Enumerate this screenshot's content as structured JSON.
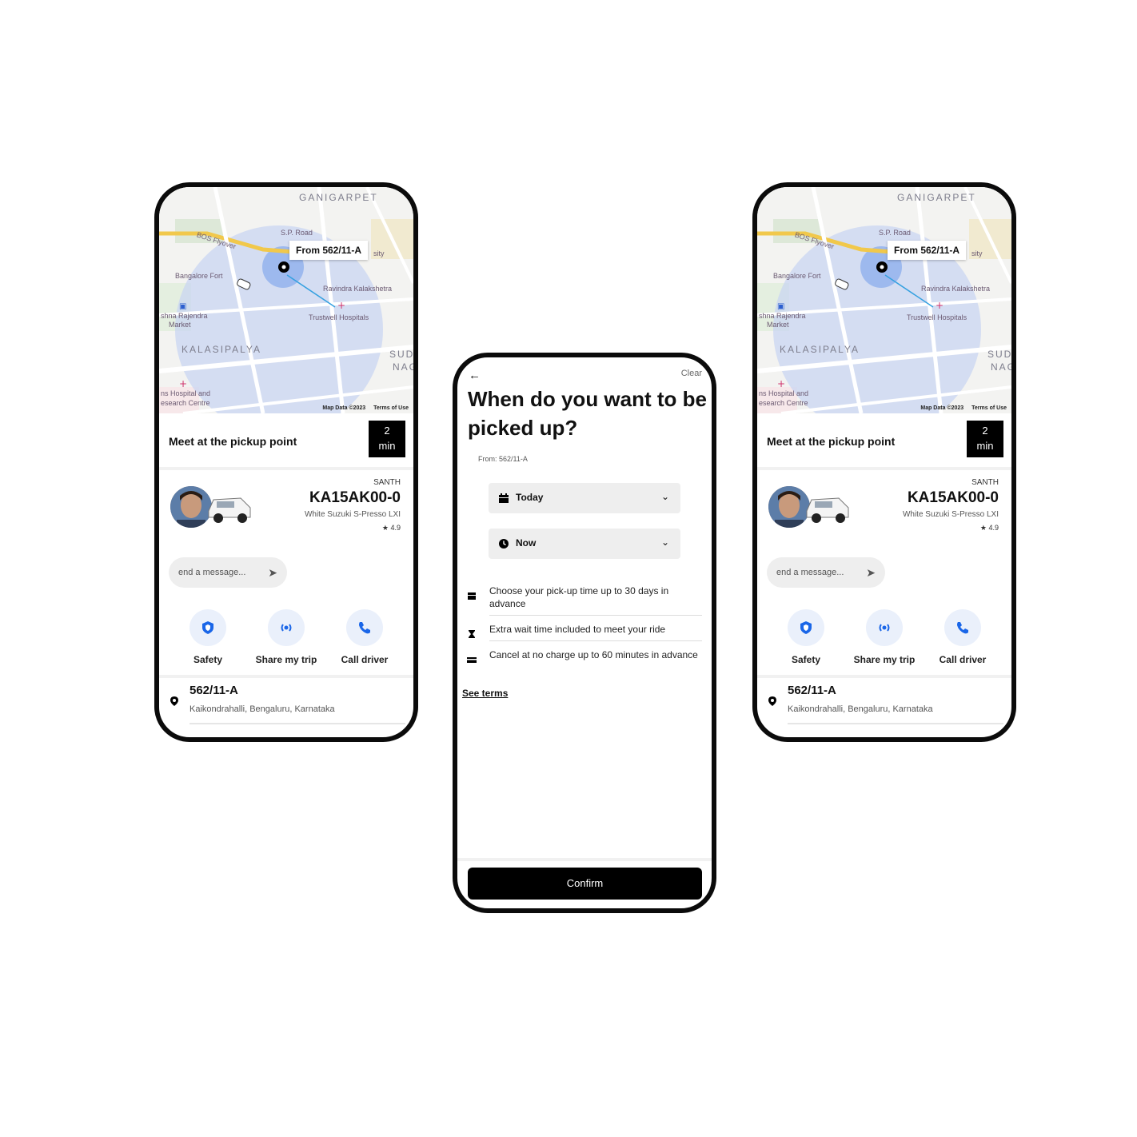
{
  "ride_card": {
    "map": {
      "from_label": "From 562/11-A",
      "labels": {
        "ganigarpet": "GANIGARPET",
        "kalasipalya": "KALASIPALYA",
        "sudh": "SUDH",
        "nag": "NAG",
        "flyover": "BOS Flyover",
        "sp_road": "S.P. Road",
        "fort": "Bangalore Fort",
        "kalakshetra": "Ravindra Kalakshetra",
        "trustwell": "Trustwell Hospitals",
        "market1": "shna Rajendra",
        "market2": "Market",
        "hospital1": "ns Hospital and",
        "hospital2": "esearch Centre",
        "ity": "sity"
      },
      "credit": "Map Data ©2023",
      "terms": "Terms of Use"
    },
    "meet_text": "Meet at the pickup point",
    "eta_value": "2",
    "eta_unit": "min",
    "driver_name": "SANTH",
    "plate": "KA15AK00-0",
    "car_model": "White Suzuki S-Presso LXI",
    "rating": "4.9",
    "message_placeholder": "end a message...",
    "actions": [
      {
        "label": "Safety",
        "icon": "shield-icon"
      },
      {
        "label": "Share my trip",
        "icon": "broadcast-icon"
      },
      {
        "label": "Call driver",
        "icon": "phone-icon"
      }
    ],
    "address_title": "562/11-A",
    "address_sub": "Kaikondrahalli, Bengaluru, Karnataka"
  },
  "schedule": {
    "back_icon": "arrow-left-icon",
    "clear": "Clear",
    "title": "When do you want to be picked up?",
    "from": "From: 562/11-A",
    "day_select": "Today",
    "time_select": "Now",
    "info": [
      {
        "icon": "calendar-icon",
        "text": "Choose your pick-up time up to 30 days in advance"
      },
      {
        "icon": "hourglass-icon",
        "text": "Extra wait time included to meet your ride"
      },
      {
        "icon": "card-icon",
        "text": "Cancel at no charge up to 60 minutes in advance"
      }
    ],
    "see_terms": "See terms",
    "confirm": "Confirm"
  },
  "colors": {
    "accent_blue": "#1a66e8",
    "map_circle": "#c9d6f2",
    "black": "#000000"
  }
}
